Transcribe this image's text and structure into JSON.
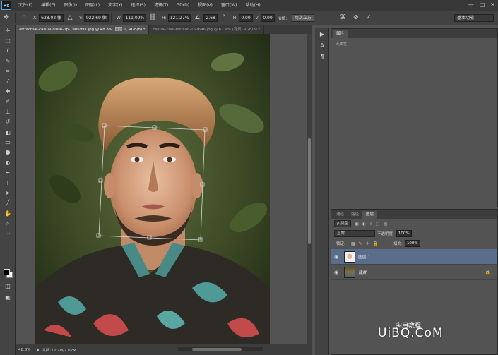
{
  "app": {
    "logo": "Ps",
    "menu": [
      "文件(F)",
      "编辑(E)",
      "图像(I)",
      "图层(L)",
      "文字(Y)",
      "选择(S)",
      "滤镜(T)",
      "3D(D)",
      "视图(V)",
      "窗口(W)",
      "帮助(H)"
    ],
    "window_controls": [
      "—",
      "□",
      "✕"
    ]
  },
  "options": {
    "x_label": "X:",
    "x_value": "638.02 像",
    "y_label": "Y:",
    "y_value": "922.69 像",
    "w_label": "W:",
    "w_value": "111.09%",
    "h_label": "H:",
    "h_value": "121.27%",
    "angle_value": "2.68",
    "hskew_label": "H:",
    "hskew_value": "0.00",
    "vskew_label": "V:",
    "vskew_value": "0.00",
    "interp_label": "插值:",
    "interp_value": "两次立方",
    "workspace": "基本功能"
  },
  "tabs": [
    {
      "label": "attractive-casual-close-up-1906997.jpg @ 48.8% (图层 1, RGB/8) *",
      "active": true
    },
    {
      "label": "casual-cool-fashion-157646.jpg @ 67.9% (背景, RGB/8) *",
      "active": false
    }
  ],
  "status": {
    "zoom": "48.8%",
    "doc": "文档:7.02M/7.02M"
  },
  "properties": {
    "tab": "属性",
    "message": "无属性"
  },
  "layers_panel": {
    "tabs": [
      "通道",
      "路径",
      "图层"
    ],
    "kind_label": "ρ 类型",
    "blend_mode": "正常",
    "opacity_label": "不透明度:",
    "opacity_value": "100%",
    "lock_label": "锁定:",
    "fill_label": "填充:",
    "fill_value": "100%",
    "layers": [
      {
        "name": "图层 1",
        "selected": true
      },
      {
        "name": "背景",
        "selected": false
      }
    ]
  },
  "watermark": {
    "text": "UiBQ.CoM",
    "sub": "实用教程"
  },
  "colors": {
    "accent": "#5a6e8c",
    "panel": "#535353"
  }
}
